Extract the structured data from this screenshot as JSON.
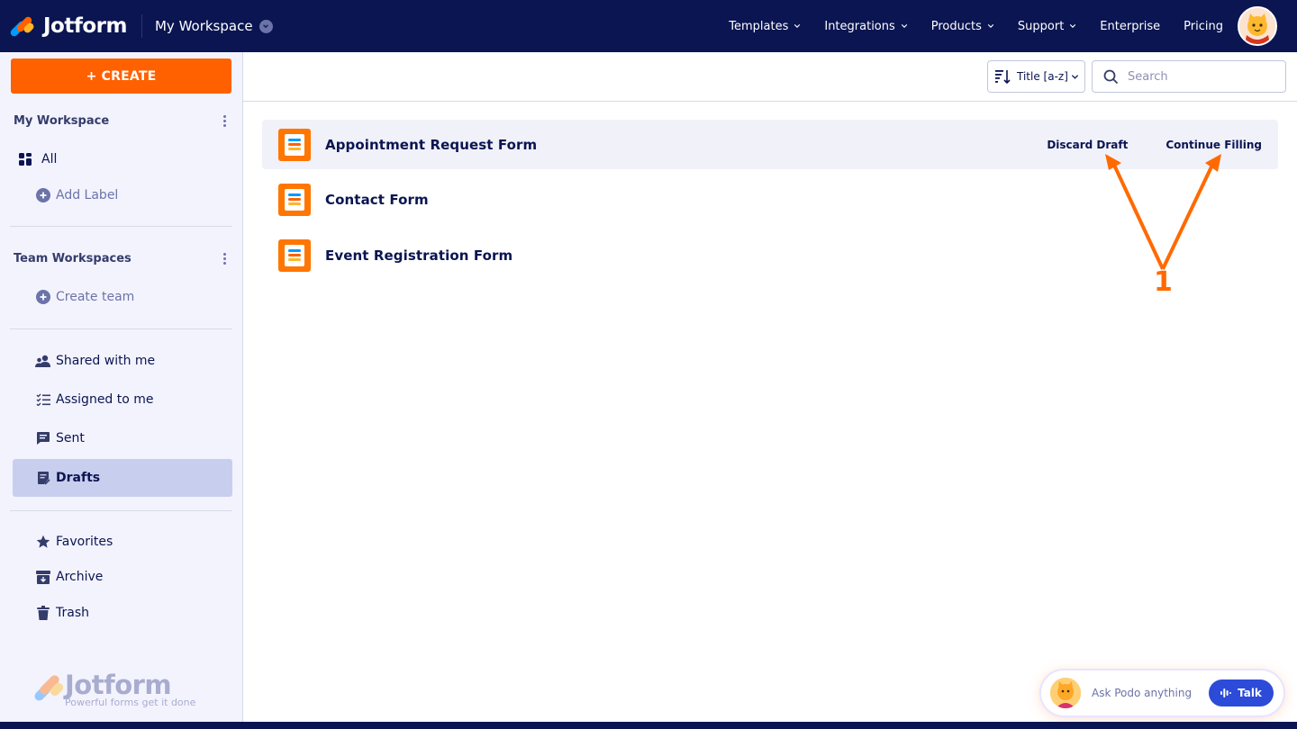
{
  "header": {
    "brand": "Jotform",
    "workspace": "My Workspace",
    "nav": [
      {
        "label": "Templates",
        "dropdown": true
      },
      {
        "label": "Integrations",
        "dropdown": true
      },
      {
        "label": "Products",
        "dropdown": true
      },
      {
        "label": "Support",
        "dropdown": true
      },
      {
        "label": "Enterprise",
        "dropdown": false
      },
      {
        "label": "Pricing",
        "dropdown": false
      }
    ]
  },
  "sidebar": {
    "create_label": "+ CREATE",
    "my_workspace": {
      "title": "My Workspace",
      "all_label": "All",
      "add_label": "Add Label"
    },
    "team_workspaces": {
      "title": "Team Workspaces",
      "create_team": "Create team"
    },
    "items": [
      {
        "label": "Shared with me",
        "icon": "users-icon"
      },
      {
        "label": "Assigned to me",
        "icon": "checklist-icon"
      },
      {
        "label": "Sent",
        "icon": "message-icon"
      },
      {
        "label": "Drafts",
        "icon": "draft-icon",
        "active": true
      }
    ],
    "items2": [
      {
        "label": "Favorites",
        "icon": "star-icon"
      },
      {
        "label": "Archive",
        "icon": "archive-icon"
      },
      {
        "label": "Trash",
        "icon": "trash-icon"
      }
    ],
    "footer_logo": {
      "wordmark": "Jotform",
      "tagline": "Powerful forms get it done"
    }
  },
  "toolbar": {
    "sort_label": "Title [a-z]",
    "search_placeholder": "Search"
  },
  "forms": [
    {
      "title": "Appointment Request Form",
      "hovered": true
    },
    {
      "title": "Contact Form",
      "hovered": false
    },
    {
      "title": "Event Registration Form",
      "hovered": false
    }
  ],
  "row_actions": {
    "discard": "Discard Draft",
    "continue": "Continue Filling"
  },
  "annotation": {
    "number": "1",
    "color": "#ff6a00"
  },
  "podo": {
    "prompt": "Ask Podo anything",
    "talk_label": "Talk"
  },
  "colors": {
    "nav_bg": "#0a1551",
    "accent_orange": "#ff6100",
    "sidebar_bg": "#f3f3fe",
    "active_item": "#c8ceed",
    "talk_blue": "#2c4bd8"
  }
}
